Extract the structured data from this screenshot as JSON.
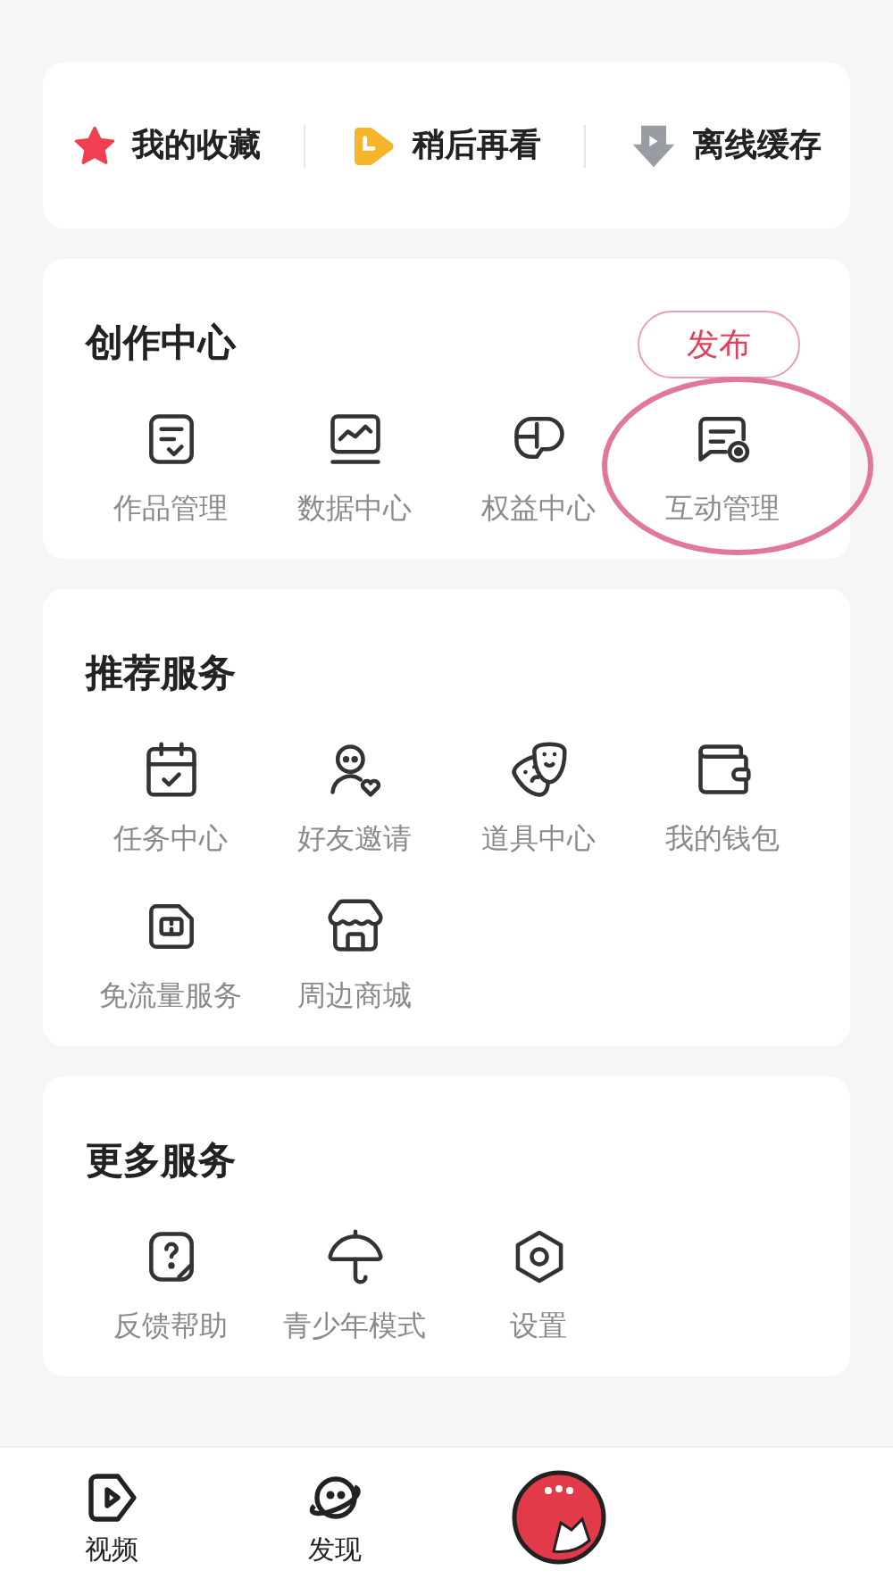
{
  "quick_links": [
    {
      "label": "我的收藏"
    },
    {
      "label": "稍后再看"
    },
    {
      "label": "离线缓存"
    }
  ],
  "sections": [
    {
      "title": "创作中心",
      "action": "发布",
      "items": [
        {
          "label": "作品管理",
          "highlighted": false
        },
        {
          "label": "数据中心",
          "highlighted": false
        },
        {
          "label": "权益中心",
          "highlighted": false
        },
        {
          "label": "互动管理",
          "highlighted": true
        }
      ]
    },
    {
      "title": "推荐服务",
      "items": [
        {
          "label": "任务中心",
          "highlighted": false
        },
        {
          "label": "好友邀请",
          "highlighted": false
        },
        {
          "label": "道具中心",
          "highlighted": false
        },
        {
          "label": "我的钱包",
          "highlighted": false
        },
        {
          "label": "免流量服务",
          "highlighted": false
        },
        {
          "label": "周边商城",
          "highlighted": false
        }
      ]
    },
    {
      "title": "更多服务",
      "items": [
        {
          "label": "反馈帮助",
          "highlighted": false
        },
        {
          "label": "青少年模式",
          "highlighted": false
        },
        {
          "label": "设置",
          "highlighted": false
        }
      ]
    }
  ],
  "tab_bar": [
    {
      "kind": "icon",
      "label": "视频"
    },
    {
      "kind": "icon",
      "label": "发现"
    },
    {
      "kind": "avatar"
    }
  ]
}
